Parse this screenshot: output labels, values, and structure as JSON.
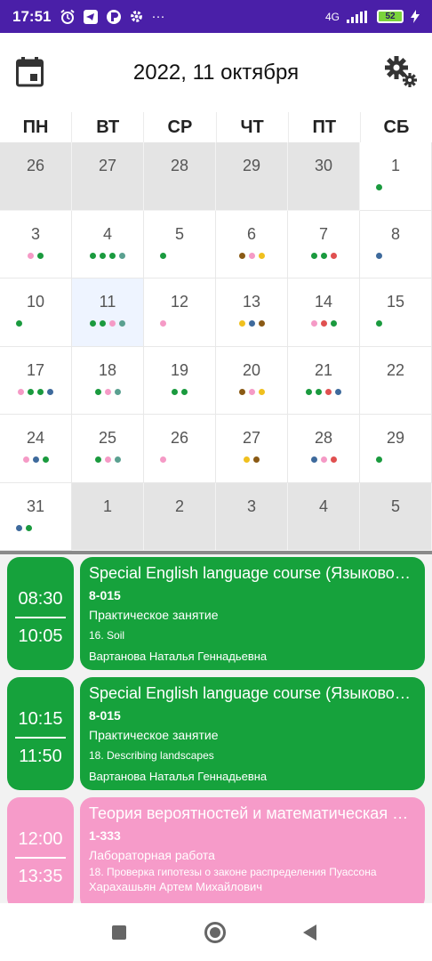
{
  "status_bar": {
    "time": "17:51",
    "network": "4G",
    "battery": "52",
    "icons": [
      "alarm-icon",
      "telegram-icon",
      "app-icon",
      "gear-icon",
      "more-icon",
      "signal-icon",
      "battery-icon",
      "charging-icon"
    ],
    "more": "···"
  },
  "header": {
    "title": "2022, 11 октября",
    "left_icon": "calendar-icon",
    "right_icon": "settings-gears-icon"
  },
  "weekdays": [
    "ПН",
    "ВТ",
    "СР",
    "ЧТ",
    "ПТ",
    "СБ"
  ],
  "colors": {
    "green": "#1a9a3e",
    "pink": "#f59ac6",
    "blue": "#3e6a9c",
    "teal": "#5aa090",
    "brown": "#8a5a14",
    "yellow": "#f0c01e",
    "red": "#e05050",
    "statusbar": "#4a1fa8",
    "lesson_green": "#16a23c",
    "lesson_pink": "#f69bc9"
  },
  "calendar": {
    "today": "11",
    "days": [
      {
        "day": "26",
        "other": true,
        "dots": []
      },
      {
        "day": "27",
        "other": true,
        "dots": []
      },
      {
        "day": "28",
        "other": true,
        "dots": []
      },
      {
        "day": "29",
        "other": true,
        "dots": []
      },
      {
        "day": "30",
        "other": true,
        "dots": []
      },
      {
        "day": "1",
        "other": false,
        "dots": [
          "green"
        ],
        "align": "left"
      },
      {
        "day": "3",
        "other": false,
        "dots": [
          "pink",
          "green"
        ]
      },
      {
        "day": "4",
        "other": false,
        "dots": [
          "green",
          "green",
          "green",
          "teal"
        ]
      },
      {
        "day": "5",
        "other": false,
        "dots": [
          "green"
        ],
        "align": "left"
      },
      {
        "day": "6",
        "other": false,
        "dots": [
          "brown",
          "pink",
          "yellow"
        ]
      },
      {
        "day": "7",
        "other": false,
        "dots": [
          "green",
          "green",
          "red"
        ]
      },
      {
        "day": "8",
        "other": false,
        "dots": [
          "blue"
        ],
        "align": "left"
      },
      {
        "day": "10",
        "other": false,
        "dots": [
          "green"
        ],
        "align": "left"
      },
      {
        "day": "11",
        "other": false,
        "today": true,
        "dots": [
          "green",
          "green",
          "pink",
          "teal"
        ]
      },
      {
        "day": "12",
        "other": false,
        "dots": [
          "pink"
        ],
        "align": "left"
      },
      {
        "day": "13",
        "other": false,
        "dots": [
          "yellow",
          "blue",
          "brown"
        ]
      },
      {
        "day": "14",
        "other": false,
        "dots": [
          "pink",
          "red",
          "green"
        ]
      },
      {
        "day": "15",
        "other": false,
        "dots": [
          "green"
        ],
        "align": "left"
      },
      {
        "day": "17",
        "other": false,
        "dots": [
          "pink",
          "green",
          "green",
          "blue"
        ]
      },
      {
        "day": "18",
        "other": false,
        "dots": [
          "green",
          "pink",
          "teal"
        ]
      },
      {
        "day": "19",
        "other": false,
        "dots": [
          "green",
          "green"
        ]
      },
      {
        "day": "20",
        "other": false,
        "dots": [
          "brown",
          "pink",
          "yellow"
        ]
      },
      {
        "day": "21",
        "other": false,
        "dots": [
          "green",
          "green",
          "red",
          "blue"
        ]
      },
      {
        "day": "22",
        "other": false,
        "dots": []
      },
      {
        "day": "24",
        "other": false,
        "dots": [
          "pink",
          "blue",
          "green"
        ]
      },
      {
        "day": "25",
        "other": false,
        "dots": [
          "green",
          "pink",
          "teal"
        ]
      },
      {
        "day": "26",
        "other": false,
        "dots": [
          "pink"
        ],
        "align": "left"
      },
      {
        "day": "27",
        "other": false,
        "dots": [
          "yellow",
          "brown"
        ]
      },
      {
        "day": "28",
        "other": false,
        "dots": [
          "blue",
          "pink",
          "red"
        ]
      },
      {
        "day": "29",
        "other": false,
        "dots": [
          "green"
        ],
        "align": "left"
      },
      {
        "day": "31",
        "other": false,
        "dots": [
          "blue",
          "green"
        ],
        "align": "left"
      },
      {
        "day": "1",
        "other": true,
        "dots": []
      },
      {
        "day": "2",
        "other": true,
        "dots": []
      },
      {
        "day": "3",
        "other": true,
        "dots": []
      },
      {
        "day": "4",
        "other": true,
        "dots": []
      },
      {
        "day": "5",
        "other": true,
        "dots": []
      }
    ]
  },
  "lessons": [
    {
      "start": "08:30",
      "end": "10:05",
      "color": "green",
      "subject": "Special English language course (Языковой курс)",
      "room": "8-015",
      "type": "Практическое занятие",
      "topic": "16. Soil",
      "teacher": "Вартанова Наталья Геннадьевна"
    },
    {
      "start": "10:15",
      "end": "11:50",
      "color": "green",
      "subject": "Special English language course (Языковой курс)",
      "room": "8-015",
      "type": "Практическое занятие",
      "topic": "18. Describing landscapes",
      "teacher": "Вартанова Наталья Геннадьевна"
    },
    {
      "start": "12:00",
      "end": "13:35",
      "color": "pink",
      "subject": "Теория вероятностей и математическая статистика",
      "room": "1-333",
      "type": "Лабораторная работа",
      "topic": "18. Проверка гипотезы о законе распределения Пуассона",
      "teacher": "Харахашьян Артем Михайлович"
    }
  ],
  "nav": {
    "icons": [
      "recents-square-icon",
      "home-circle-icon",
      "back-triangle-icon"
    ]
  }
}
